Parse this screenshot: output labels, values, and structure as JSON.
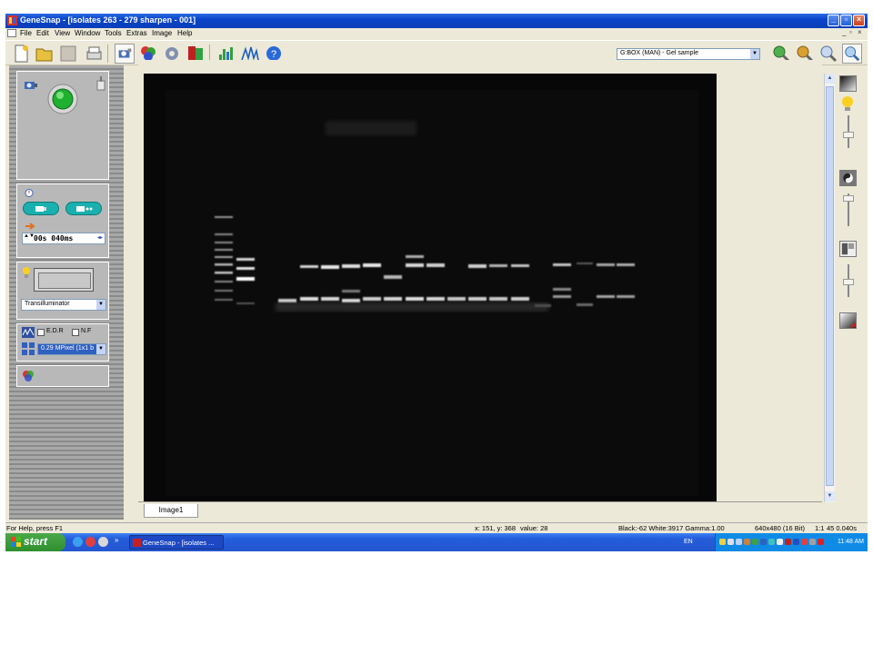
{
  "window": {
    "title": "GeneSnap - [isolates 263 - 279 sharpen - 001]"
  },
  "menu": [
    "File",
    "Edit",
    "View",
    "Window",
    "Tools",
    "Extras",
    "Image",
    "Help"
  ],
  "toolbar": {
    "icons": [
      "new-icon",
      "open-icon",
      "save-icon",
      "print-icon",
      "capture-icon",
      "colorize-icon",
      "settings-icon",
      "export-icon",
      "histogram-icon",
      "profile-icon",
      "help-icon"
    ],
    "source_select": "G:BOX (MAN) - Gel sample",
    "zoom_icons": [
      "zoom-in-icon",
      "zoom-out-icon",
      "zoom-fit-icon",
      "zoom-actual-icon"
    ]
  },
  "left_panel": {
    "exposure_time": "00s 040ms",
    "light_select": "Transilluminator",
    "edr_label": "E.D.R",
    "nf_label": "N.F",
    "resolution_select": "0.29 MPixel (1x1 b"
  },
  "tab": {
    "label": "Image1"
  },
  "status": {
    "help": "For Help, press F1",
    "coords": "x: 151, y: 368",
    "value": "value: 28",
    "levels": "Black:-62 White:3917 Gamma:1.00",
    "size": "640x480 (16 Bit)",
    "scale": "1:1",
    "time": "45 0.040s"
  },
  "taskbar": {
    "start_label": "start",
    "task_label": "GeneSnap - [isolates ...",
    "lang": "EN",
    "clock": "11:48 AM"
  }
}
